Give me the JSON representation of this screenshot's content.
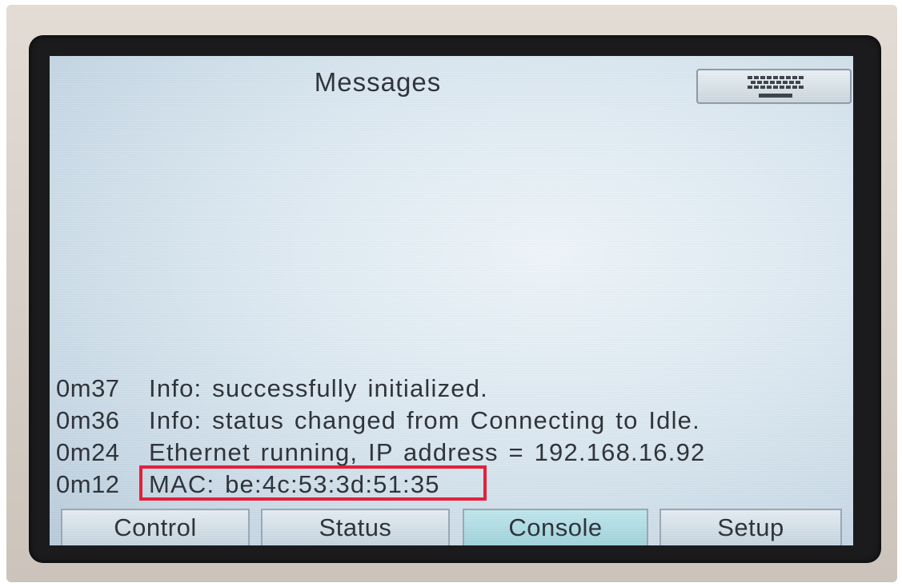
{
  "screen": {
    "title": "Messages",
    "keyboard_button": {
      "icon": "keyboard-icon"
    }
  },
  "log": {
    "entries": [
      {
        "time": "0m37",
        "message": "Info: successfully initialized."
      },
      {
        "time": "0m36",
        "message": "Info: status changed from Connecting to Idle."
      },
      {
        "time": "0m24",
        "message": "Ethernet running, IP address = 192.168.16.92"
      },
      {
        "time": "0m12",
        "message": "MAC: be:4c:53:3d:51:35"
      }
    ]
  },
  "tabs": [
    {
      "label": "Control",
      "active": false
    },
    {
      "label": "Status",
      "active": false
    },
    {
      "label": "Console",
      "active": true
    },
    {
      "label": "Setup",
      "active": false
    }
  ],
  "colors": {
    "highlight": "#e3203a",
    "active_tab": "#a9d8e0",
    "screen_bg": "#dbe8f1"
  }
}
